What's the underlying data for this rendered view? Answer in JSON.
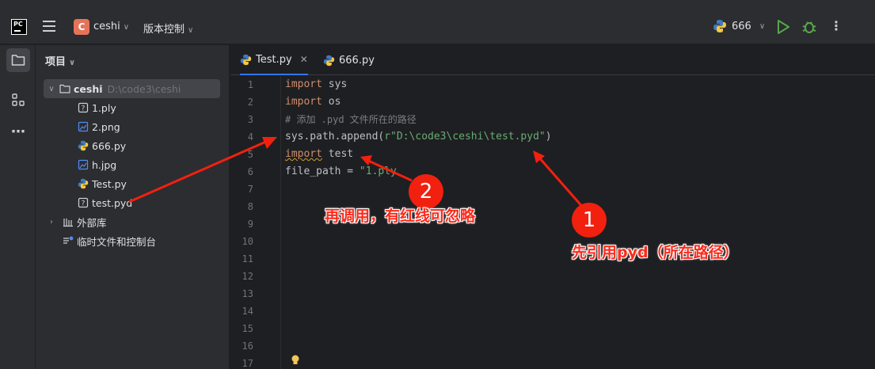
{
  "titlebar": {
    "logo": "PC",
    "project_initial": "C",
    "project_name": "ceshi",
    "vcs_label": "版本控制",
    "run_config": "666"
  },
  "project_panel": {
    "title": "项目",
    "root": {
      "name": "ceshi",
      "path": "D:\\code3\\ceshi"
    },
    "files": [
      {
        "name": "1.ply",
        "icon": "unknown-file-icon"
      },
      {
        "name": "2.png",
        "icon": "image-file-icon"
      },
      {
        "name": "666.py",
        "icon": "python-file-icon"
      },
      {
        "name": "h.jpg",
        "icon": "image-file-icon"
      },
      {
        "name": "Test.py",
        "icon": "python-file-icon"
      },
      {
        "name": "test.pyd",
        "icon": "unknown-file-icon"
      }
    ],
    "external_libs": "外部库",
    "scratches": "临时文件和控制台"
  },
  "tabs": [
    {
      "label": "Test.py",
      "active": true
    },
    {
      "label": "666.py",
      "active": false
    }
  ],
  "editor": {
    "line_numbers": [
      "1",
      "2",
      "3",
      "4",
      "5",
      "6",
      "7",
      "8",
      "9",
      "10",
      "11",
      "12",
      "13",
      "14",
      "15",
      "16",
      "17"
    ],
    "code": {
      "l1_kw": "import",
      "l1_rest": " sys",
      "l2_kw": "import",
      "l2_rest": " os",
      "l3": "# 添加 .pyd 文件所在的路径",
      "l4_pre": "sys.path.append(",
      "l4_str": "r\"D:\\code3\\ceshi\\test.pyd\"",
      "l4_post": ")",
      "l5_kw": "import",
      "l5_rest": " test",
      "l6_pre": "file_path = ",
      "l6_str": "\"1.ply"
    }
  },
  "annotations": {
    "badge1": "1",
    "badge2": "2",
    "text1": "先引用pyd（所在路径）",
    "text2": "再调用，有红线可忽略"
  },
  "colors": {
    "arrow_red": "#f2200f",
    "accent_blue": "#3574f0",
    "keyword": "#cf8e6d",
    "string": "#6aab73",
    "comment": "#7a7e85"
  }
}
